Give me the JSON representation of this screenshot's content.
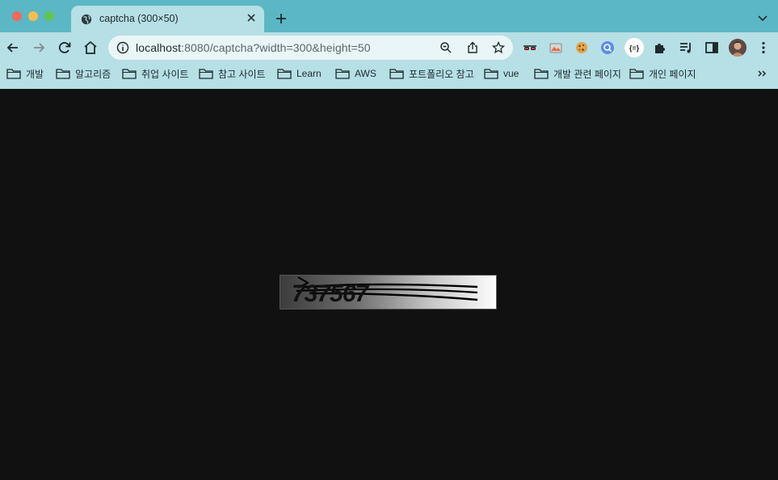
{
  "window": {
    "tab_title": "captcha (300×50)",
    "icons": {
      "tab_favicon": "globe-icon",
      "tab_close": "close-icon",
      "new_tab": "plus-icon",
      "tab_search": "chevron-down-icon"
    }
  },
  "toolbar": {
    "url_host": "localhost",
    "url_rest": ":8080/captcha?width=300&height=50",
    "icons": [
      "back-arrow-icon",
      "forward-arrow-icon",
      "reload-icon",
      "home-icon",
      "info-icon",
      "zoom-icon",
      "share-icon",
      "star-icon"
    ],
    "extensions": [
      "incognito-glasses-icon",
      "image-extension-icon",
      "cookie-icon",
      "search-lens-icon",
      "json-extension-icon",
      "puzzle-icon",
      "reading-list-icon",
      "side-panel-icon",
      "profile-avatar",
      "menu-dots-icon"
    ]
  },
  "bookmarks": [
    {
      "label": "개발"
    },
    {
      "label": "알고리즘"
    },
    {
      "label": "취업 사이트"
    },
    {
      "label": "참고 사이트"
    },
    {
      "label": "Learn"
    },
    {
      "label": "AWS"
    },
    {
      "label": "포트폴리오 참고"
    },
    {
      "label": "vue"
    },
    {
      "label": "개발 관련 페이지"
    },
    {
      "label": "개인 페이지"
    }
  ],
  "page": {
    "captcha_text": "737567",
    "colors": {
      "background": "#111111",
      "tabstrip": "#5bb7c4",
      "toolbar": "#b6dfe6"
    }
  }
}
